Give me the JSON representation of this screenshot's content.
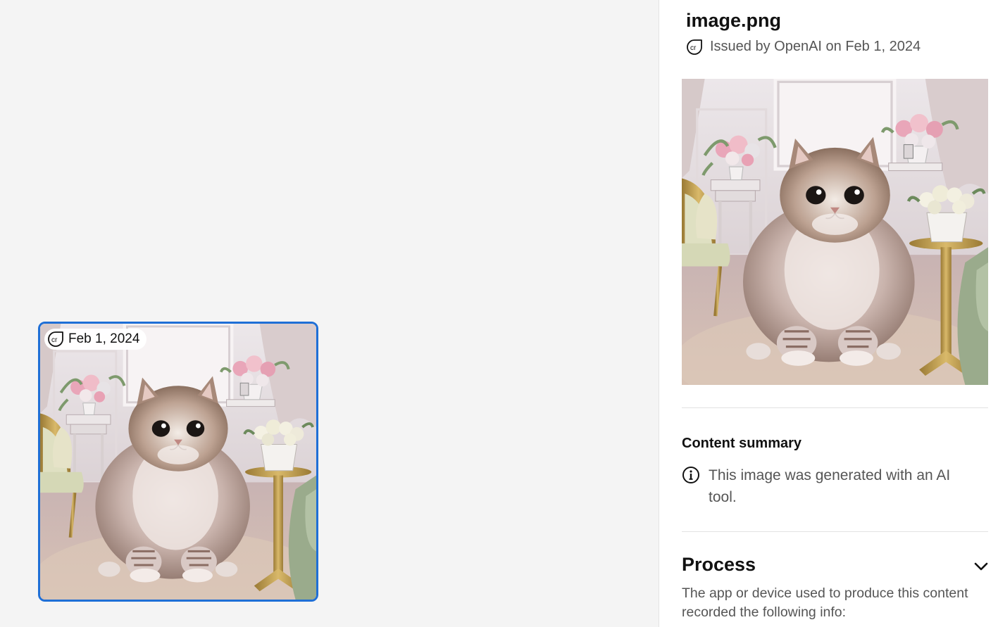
{
  "thumbnail": {
    "badge_date": "Feb 1, 2024"
  },
  "panel": {
    "file_name": "image.png",
    "issued_by": "Issued by OpenAI on Feb 1, 2024",
    "content_summary": {
      "heading": "Content summary",
      "text": "This image was generated with an AI tool."
    },
    "process": {
      "heading": "Process",
      "description": "The app or device used to produce this content recorded the following info:"
    }
  },
  "colors": {
    "selection_border": "#1f6fd6",
    "canvas_bg": "#f4f4f4",
    "panel_bg": "#ffffff"
  },
  "icons": {
    "credential": "content-credentials-icon",
    "info": "info-icon",
    "expand": "chevron-down-icon"
  }
}
